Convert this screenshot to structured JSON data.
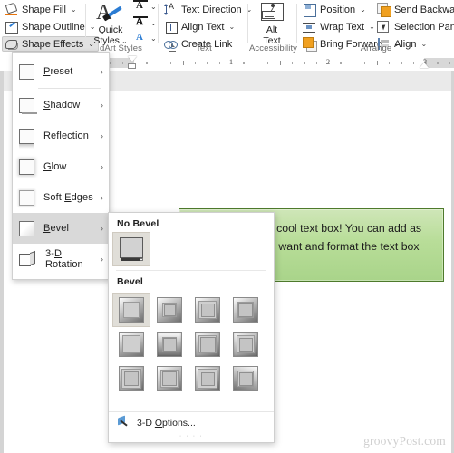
{
  "ribbon": {
    "shape_styles": {
      "commands": [
        {
          "label": "Shape Fill",
          "caret": "⌄",
          "icon": "paint-bucket-icon"
        },
        {
          "label": "Shape Outline",
          "caret": "⌄",
          "icon": "pencil-outline-icon"
        },
        {
          "label": "Shape Effects",
          "caret": "⌄",
          "icon": "shape-effects-icon"
        }
      ]
    },
    "wordart_styles": {
      "group_label": "dArt Styles",
      "quick_styles_label_line1": "Quick",
      "quick_styles_label_line2": "Styles",
      "quick_styles_caret": "⌄",
      "minis": [
        {
          "name": "text-fill",
          "glyph": "A",
          "caret": "⌄"
        },
        {
          "name": "text-outline",
          "glyph": "A",
          "caret": "⌄"
        },
        {
          "name": "text-effects",
          "glyph": "A",
          "caret": "⌄"
        }
      ]
    },
    "text_group": {
      "group_label": "Text",
      "commands": [
        {
          "label": "Text Direction",
          "caret": "⌄",
          "icon": "text-direction-icon"
        },
        {
          "label": "Align Text",
          "caret": "⌄",
          "icon": "align-text-icon"
        },
        {
          "label": "Create Link",
          "caret": "",
          "icon": "create-link-icon"
        }
      ]
    },
    "accessibility_group": {
      "group_label": "Accessibility",
      "alt_text_line1": "Alt",
      "alt_text_line2": "Text"
    },
    "arrange_group": {
      "group_label": "Arrange",
      "col1": [
        {
          "label": "Position",
          "caret": "⌄",
          "icon": "position-icon"
        },
        {
          "label": "Wrap Text",
          "caret": "⌄",
          "icon": "wrap-text-icon"
        },
        {
          "label": "Bring Forward",
          "caret": "⌄",
          "icon": "bring-forward-icon"
        }
      ],
      "col2": [
        {
          "label": "Send Backward",
          "caret": "⌄",
          "icon": "send-backward-icon"
        },
        {
          "label": "Selection Pane",
          "caret": "",
          "icon": "selection-pane-icon"
        },
        {
          "label": "Align",
          "caret": "⌄",
          "icon": "align-objects-icon"
        }
      ]
    }
  },
  "ruler": {
    "numbers": [
      "1",
      "2",
      "3"
    ]
  },
  "document": {
    "textbox": {
      "text": "Here’s our super cool text box! You can add as much text as you want and format the text box any way you like.",
      "fill_color": "#b8dd98",
      "border_color": "#4e7a2c"
    },
    "watermark": "groovyPost.com"
  },
  "shape_effects_menu": {
    "items": [
      {
        "label": "Preset",
        "underline": "P",
        "icon": "preset-square-icon",
        "chevron": "›",
        "highlighted": false
      },
      {
        "label": "Shadow",
        "underline": "S",
        "icon": "shadow-square-icon",
        "chevron": "›",
        "highlighted": false
      },
      {
        "label": "Reflection",
        "underline": "R",
        "icon": "reflection-square-icon",
        "chevron": "›",
        "highlighted": false
      },
      {
        "label": "Glow",
        "underline": "G",
        "icon": "glow-square-icon",
        "chevron": "›",
        "highlighted": false
      },
      {
        "label": "Soft Edges",
        "underline": "E",
        "icon": "soft-edges-square-icon",
        "chevron": "›",
        "highlighted": false
      },
      {
        "label": "Bevel",
        "underline": "B",
        "icon": "bevel-square-icon",
        "chevron": "›",
        "highlighted": true
      },
      {
        "label": "3-D Rotation",
        "underline": "D",
        "icon": "3d-rotation-cube-icon",
        "chevron": "›",
        "highlighted": false
      }
    ]
  },
  "bevel_gallery": {
    "no_bevel_heading": "No Bevel",
    "bevel_heading": "Bevel",
    "no_bevel_selected": true,
    "selected_bevel_index": 0,
    "bevel_count": 12,
    "options_label": "3-D Options...",
    "options_icon": "3d-options-icon"
  }
}
